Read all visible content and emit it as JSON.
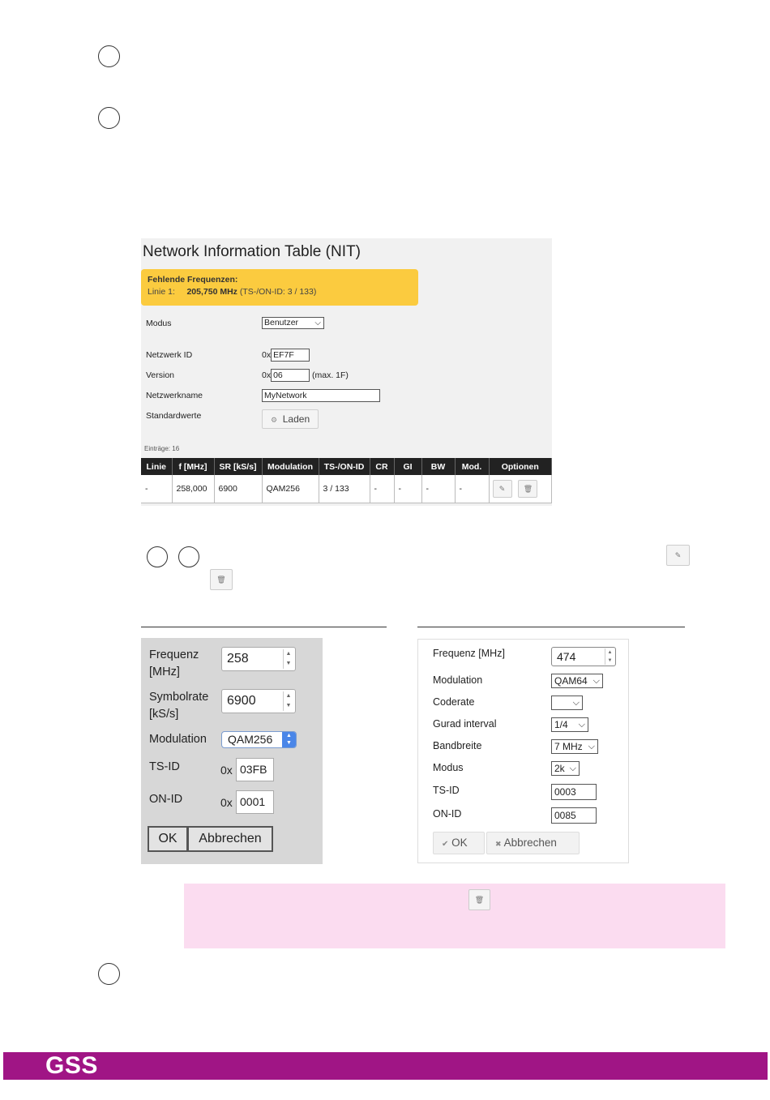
{
  "nit": {
    "title": "Network Information Table (NIT)",
    "warning_title": "Fehlende Frequenzen:",
    "warning_line_label": "Linie 1:",
    "warning_freq": "205,750 MHz",
    "warning_ids": "(TS-/ON-ID: 3 / 133)",
    "mode_label": "Modus",
    "mode_value": "Benutzer",
    "network_id_label": "Netzwerk ID",
    "network_id_prefix": "0x",
    "network_id_value": "EF7F",
    "version_label": "Version",
    "version_prefix": "0x",
    "version_value": "06",
    "version_hint": "(max. 1F)",
    "network_name_label": "Netzwerkname",
    "network_name_value": "MyNetwork",
    "defaults_label": "Standardwerte",
    "load_button": "Laden",
    "entries_count": "Einträge: 16",
    "columns": [
      "Linie",
      "f [MHz]",
      "SR [kS/s]",
      "Modulation",
      "TS-/ON-ID",
      "CR",
      "GI",
      "BW",
      "Mod.",
      "Optionen"
    ],
    "row": [
      "-",
      "258,000",
      "6900",
      "QAM256",
      "3 / 133",
      "-",
      "-",
      "-",
      "-"
    ]
  },
  "dialog_left": {
    "freq_label_1": "Frequenz",
    "freq_label_2": "[MHz]",
    "freq_value": "258",
    "sr_label_1": "Symbolrate",
    "sr_label_2": "[kS/s]",
    "sr_value": "6900",
    "modulation_label": "Modulation",
    "modulation_value": "QAM256",
    "tsid_label": "TS-ID",
    "tsid_prefix": "0x",
    "tsid_value": "03FB",
    "onid_label": "ON-ID",
    "onid_prefix": "0x",
    "onid_value": "0001",
    "ok_button": "OK",
    "cancel_button": "Abbrechen"
  },
  "dialog_right": {
    "freq_label": "Frequenz [MHz]",
    "freq_value": "474",
    "modulation_label": "Modulation",
    "modulation_value": "QAM64",
    "coderate_label": "Coderate",
    "coderate_value": "",
    "guard_label": "Gurad interval",
    "guard_value": "1/4",
    "bandwidth_label": "Bandbreite",
    "bandwidth_value": "7 MHz",
    "mode_label": "Modus",
    "mode_value": "2k",
    "tsid_label": "TS-ID",
    "tsid_value": "0003",
    "onid_label": "ON-ID",
    "onid_value": "0085",
    "ok_button": "OK",
    "cancel_button": "Abbrechen"
  },
  "footer": {
    "logo": "GSS"
  },
  "icons": {
    "edit": "✎",
    "delete": "🗑",
    "check": "✔",
    "close": "✖",
    "gear": "⚙"
  },
  "colors": {
    "warning": "#fbcb3f",
    "note_bg": "#fbdcf0",
    "footer": "#a01585"
  }
}
